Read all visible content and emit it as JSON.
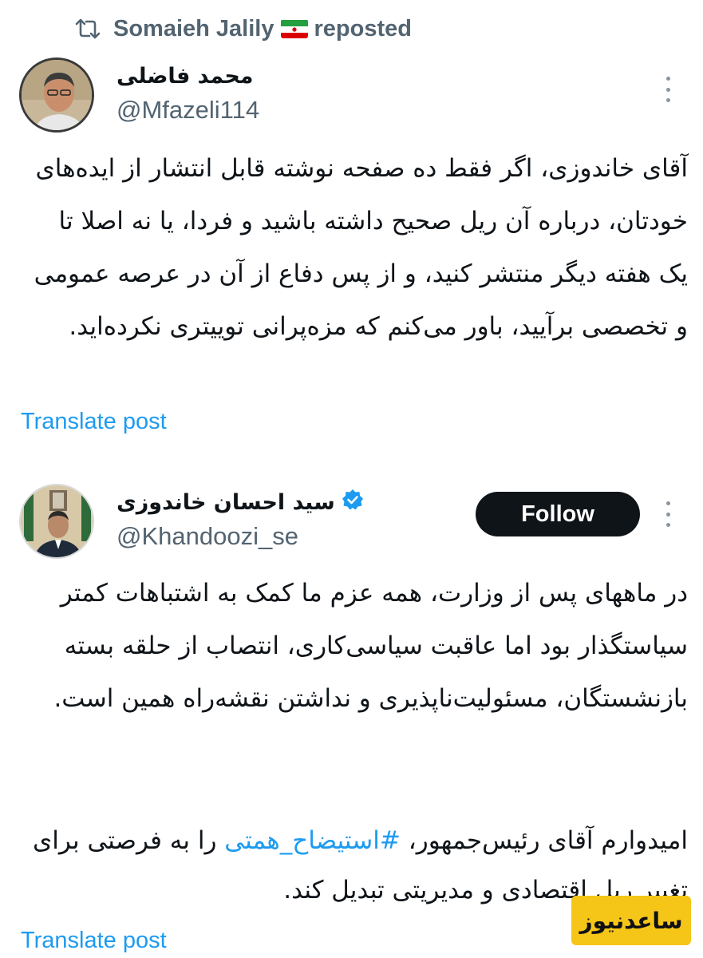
{
  "repost": {
    "user": "Somaieh Jalily",
    "label": "reposted",
    "icon": "repost-icon",
    "flag_icon": "iran-flag-icon"
  },
  "tweet1": {
    "display_name": "محمد فاضلی",
    "handle": "@Mfazeli114",
    "text": "آقای خاندوزی، اگر فقط ده صفحه نوشته قابل انتشار از ایده‌های خودتان، درباره آن ریل صحیح داشته باشید و فردا، یا نه اصلا تا یک هفته دیگر منتشر کنید، و از پس دفاع از آن در عرصه عمومی و تخصصی برآیید، باور می‌کنم که مزه‌پرانی توییتری نکرده‌اید.",
    "translate_label": "Translate post"
  },
  "tweet2": {
    "display_name": "سید احسان خاندوزی",
    "handle": "@Khandoozi_se",
    "verified_icon": "verified-badge-icon",
    "follow_label": "Follow",
    "paragraph1": "در ماههای پس از وزارت، همه عزم ما کمک به اشتباهات کمتر سیاستگذار بود اما عاقبت سیاسی‌کاری، انتصاب از حلقه بسته بازنشستگان، مسئولیت‌ناپذیری و نداشتن نقشه‌راه همین است.",
    "paragraph2_before": "امیدوارم آقای رئیس‌جمهور، ",
    "hashtag": "#استیضاح_همتی",
    "paragraph2_after": " را به فرصتی برای تغییر ریل اقتصادی و مدیریتی تبدیل کند.",
    "translate_label": "Translate post"
  },
  "watermark": {
    "text": "ساعدنیوز"
  },
  "colors": {
    "link": "#1d9bf0",
    "muted": "#536471",
    "text": "#0f1419",
    "watermark_bg": "#f5c518"
  }
}
